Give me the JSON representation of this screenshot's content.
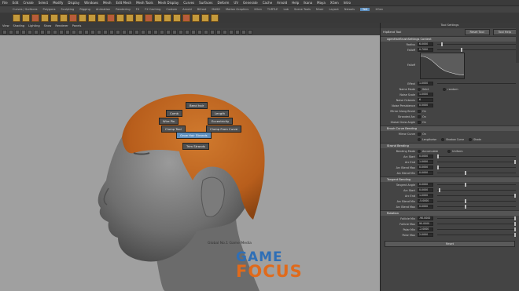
{
  "menubar": {
    "items": [
      "File",
      "Edit",
      "Create",
      "Select",
      "Modify",
      "Display",
      "Windows",
      "Mesh",
      "Edit Mesh",
      "Mesh Tools",
      "Mesh Display",
      "Curves",
      "Surfaces",
      "Deform",
      "UV",
      "Generate",
      "Cache",
      "Arnold",
      "Help"
    ],
    "more": [
      "Ikana",
      "Maya",
      "XGen",
      "Intro"
    ]
  },
  "shelf_tabs": [
    "Curves / Surfaces",
    "Polygons",
    "Sculpting",
    "Rigging",
    "Animation",
    "Rendering",
    "FX",
    "FX Caching",
    "Custom",
    "Arnold",
    "Bifrost",
    "MASH",
    "Motion Graphics",
    "XGen",
    "TURTLE",
    "Lab",
    "Scene Tools",
    "Nhair",
    "Layout",
    "Nstools",
    "Yeti",
    "XGen"
  ],
  "shelf_active_index": 20,
  "panel_menu": [
    "View",
    "Shading",
    "Lighting",
    "Show",
    "Renderer",
    "Panels"
  ],
  "viewport": {
    "marking_menu": [
      {
        "label": "Bend hair",
        "name": "mm-bend-hair",
        "selected": false
      },
      {
        "label": "Comb",
        "name": "mm-comb",
        "selected": false
      },
      {
        "label": "Length",
        "name": "mm-length",
        "selected": false
      },
      {
        "label": "Wire Pin",
        "name": "mm-wire-pin",
        "selected": false
      },
      {
        "label": "Eccentricity",
        "name": "mm-eccentricity",
        "selected": false
      },
      {
        "label": "Clump Tool",
        "name": "mm-clump-tool",
        "selected": false
      },
      {
        "label": "Clump From Curve",
        "name": "mm-clump-from-curve",
        "selected": false
      },
      {
        "label": "Grow Hair Strands",
        "name": "mm-grow-hair",
        "selected": true
      },
      {
        "label": "Trim Strands",
        "name": "mm-trim-strands",
        "selected": false
      }
    ],
    "watermark_text": "Global No.1 Game Media",
    "logo_line1": "GAME",
    "logo_line2": "FOCUS"
  },
  "tool_settings": {
    "title": "Tool Settings",
    "tool_name": "HipBend Tool",
    "reset_tool_label": "Reset Tool",
    "tool_help_label": "Tool Help",
    "sections": {
      "brush": "xgenHairBrushSettings Context",
      "brush_curve": "Brush Curve Bending",
      "strand": "Strand Bending",
      "tangent": "Tangent Bending",
      "rotation": "Rotation"
    },
    "brush_rows": [
      {
        "label": "Radius",
        "value": "6.0000",
        "slider": 0.05
      },
      {
        "label": "Falloff",
        "value": "0.7000",
        "slider": 0.3
      }
    ],
    "falloff_graph_label": "Falloff",
    "effect": {
      "label": "Effect",
      "value": "1.0000"
    },
    "name_mode": {
      "label": "Name Mode",
      "options": [
        "Selct",
        "random"
      ]
    },
    "noise_scale": {
      "label": "Noise Scale",
      "value": "1.0000"
    },
    "noise_octaves": {
      "label": "Noise Octaves",
      "value": "6"
    },
    "noise_persistence": {
      "label": "Noise Persistence",
      "value": "0.5000"
    },
    "checkboxes": [
      {
        "label": "Mirror Along Brush",
        "state": "On"
      },
      {
        "label": "Stranded Arc",
        "state": "On"
      },
      {
        "label": "Global Grow Angle",
        "state": "On"
      }
    ],
    "brush_curve_rows": [
      {
        "label": "Mirror Curve",
        "state": "On"
      },
      {
        "label": "",
        "options": [
          "Lengthwise",
          "Shadow Curve",
          "Shade"
        ]
      }
    ],
    "strand_mode": {
      "label": "Bending Mode",
      "options": [
        "Accumulate",
        "Uniform"
      ]
    },
    "strand_rows": [
      {
        "label": "Arc Start",
        "value": "0.0000",
        "slider": 0.0
      },
      {
        "label": "Arc End",
        "value": "1.0000",
        "slider": 0.98
      },
      {
        "label": "Arc Blend Max",
        "value": "0.0000",
        "slider": 0.0
      },
      {
        "label": "Arc Blend Min",
        "value": "0.0000",
        "slider": 0.35
      }
    ],
    "tangent_rows": [
      {
        "label": "Tangent Angle",
        "value": "0.0000",
        "slider": 0.35
      },
      {
        "label": "Arc Start",
        "value": "0.0000",
        "slider": 0.02
      },
      {
        "label": "Arc End",
        "value": "1.0000",
        "slider": 0.98
      },
      {
        "label": "Arc Blend Min",
        "value": "-5.0000",
        "slider": 0.35
      },
      {
        "label": "Arc Blend Max",
        "value": "0.0000",
        "slider": 0.35
      }
    ],
    "rotation_rows": [
      {
        "label": "Follicle Min",
        "value": "-90.0000",
        "slider": 0.98
      },
      {
        "label": "Follicle Max",
        "value": "90.0000",
        "slider": 0.98
      },
      {
        "label": "Polar Min",
        "value": "-2.0000",
        "slider": 0.98
      },
      {
        "label": "Polar Max",
        "value": "2.0000",
        "slider": 0.98
      }
    ],
    "reset_label": "Reset"
  }
}
